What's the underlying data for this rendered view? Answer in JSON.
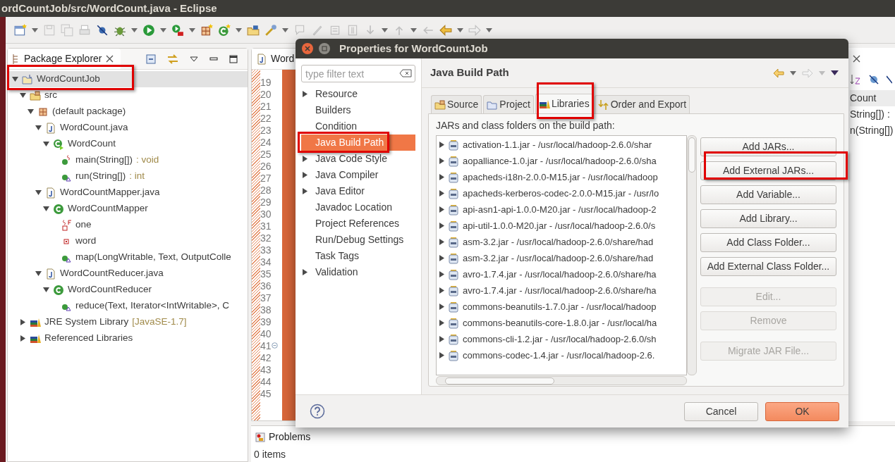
{
  "window": {
    "title": "ordCountJob/src/WordCount.java - Eclipse"
  },
  "package_explorer": {
    "tab": "Package Explorer",
    "tree": [
      {
        "label": "WordCountJob",
        "kind": "project",
        "expanded": true,
        "selected": true,
        "children": [
          {
            "label": "src",
            "kind": "source-folder",
            "expanded": true,
            "selected": false,
            "children": [
              {
                "label": "(default package)",
                "kind": "package",
                "expanded": true,
                "selected": false,
                "children": [
                  {
                    "label": "WordCount.java",
                    "kind": "java-file",
                    "expanded": true,
                    "selected": false,
                    "children": [
                      {
                        "label": "WordCount",
                        "kind": "main-class",
                        "expanded": true,
                        "selected": false,
                        "children": [
                          {
                            "label": "main(String[])",
                            "suffix": ": void",
                            "kind": "static-method",
                            "selected": false
                          },
                          {
                            "label": "run(String[])",
                            "suffix": ": int",
                            "kind": "method",
                            "selected": false
                          }
                        ]
                      }
                    ]
                  },
                  {
                    "label": "WordCountMapper.java",
                    "kind": "java-file",
                    "expanded": true,
                    "selected": false,
                    "children": [
                      {
                        "label": "WordCountMapper",
                        "kind": "class",
                        "expanded": true,
                        "selected": false,
                        "children": [
                          {
                            "label": "one",
                            "kind": "static-field",
                            "selected": false
                          },
                          {
                            "label": "word",
                            "kind": "field",
                            "selected": false
                          },
                          {
                            "label": "map(LongWritable, Text, OutputColle",
                            "kind": "method",
                            "selected": false
                          }
                        ]
                      }
                    ]
                  },
                  {
                    "label": "WordCountReducer.java",
                    "kind": "java-file",
                    "expanded": true,
                    "selected": false,
                    "children": [
                      {
                        "label": "WordCountReducer",
                        "kind": "class",
                        "expanded": true,
                        "selected": false,
                        "children": [
                          {
                            "label": "reduce(Text, Iterator<IntWritable>, C",
                            "kind": "method",
                            "selected": false
                          }
                        ]
                      }
                    ]
                  }
                ]
              }
            ]
          },
          {
            "label": "JRE System Library",
            "suffix": "[JavaSE-1.7]",
            "kind": "library",
            "expanded": false,
            "selected": false
          },
          {
            "label": "Referenced Libraries",
            "kind": "library",
            "expanded": false,
            "selected": false
          }
        ]
      }
    ]
  },
  "editor": {
    "tab": "Word",
    "lines": [
      {
        "number": "19",
        "fold_marker": false
      },
      {
        "number": "20",
        "fold_marker": false
      },
      {
        "number": "21",
        "fold_marker": false
      },
      {
        "number": "22",
        "fold_marker": false
      },
      {
        "number": "23",
        "fold_marker": false
      },
      {
        "number": "24",
        "fold_marker": false
      },
      {
        "number": "25",
        "fold_marker": false
      },
      {
        "number": "26",
        "fold_marker": false
      },
      {
        "number": "27",
        "fold_marker": false
      },
      {
        "number": "28",
        "fold_marker": false
      },
      {
        "number": "29",
        "fold_marker": false
      },
      {
        "number": "30",
        "fold_marker": false
      },
      {
        "number": "31",
        "fold_marker": false
      },
      {
        "number": "32",
        "fold_marker": false
      },
      {
        "number": "33",
        "fold_marker": false
      },
      {
        "number": "34",
        "fold_marker": false
      },
      {
        "number": "35",
        "fold_marker": false
      },
      {
        "number": "36",
        "fold_marker": false
      },
      {
        "number": "37",
        "fold_marker": false
      },
      {
        "number": "38",
        "fold_marker": false
      },
      {
        "number": "39",
        "fold_marker": false
      },
      {
        "number": "40",
        "fold_marker": false
      },
      {
        "number": "41",
        "fold_marker": true
      },
      {
        "number": "42",
        "fold_marker": false
      },
      {
        "number": "43",
        "fold_marker": false
      },
      {
        "number": "44",
        "fold_marker": false
      },
      {
        "number": "45",
        "fold_marker": false
      }
    ]
  },
  "outline": {
    "rows": [
      {
        "label": "Count",
        "selected": true
      },
      {
        "label": "String[]) :",
        "selected": false
      },
      {
        "label": "n(String[])",
        "selected": false
      }
    ]
  },
  "problems": {
    "tab": "Problems",
    "status": "0 items"
  },
  "dialog": {
    "title": "Properties for WordCountJob",
    "filter": {
      "placeholder": "type filter text"
    },
    "categories": [
      {
        "label": "Resource",
        "expanded": false,
        "selected": false
      },
      {
        "label": "Builders",
        "selected": false
      },
      {
        "label": "Condition",
        "selected": false
      },
      {
        "label": "Java Build Path",
        "selected": true
      },
      {
        "label": "Java Code Style",
        "expanded": false,
        "selected": false
      },
      {
        "label": "Java Compiler",
        "expanded": false,
        "selected": false
      },
      {
        "label": "Java Editor",
        "expanded": false,
        "selected": false
      },
      {
        "label": "Javadoc Location",
        "selected": false
      },
      {
        "label": "Project References",
        "selected": false
      },
      {
        "label": "Run/Debug Settings",
        "selected": false
      },
      {
        "label": "Task Tags",
        "selected": false
      },
      {
        "label": "Validation",
        "expanded": false,
        "selected": false
      }
    ],
    "page_title": "Java Build Path",
    "tabs": [
      {
        "label": "Source",
        "kind": "source",
        "selected": false
      },
      {
        "label": "Project",
        "kind": "projects",
        "selected": false
      },
      {
        "label": "Libraries",
        "kind": "libraries",
        "selected": true
      },
      {
        "label": "Order and Export",
        "kind": "order",
        "selected": false
      }
    ],
    "list_label": "JARs and class folders on the build path:",
    "entries": [
      {
        "label": "activation-1.1.jar - /usr/local/hadoop-2.6.0/shar",
        "expanded": false
      },
      {
        "label": "aopalliance-1.0.jar - /usr/local/hadoop-2.6.0/sha",
        "expanded": false
      },
      {
        "label": "apacheds-i18n-2.0.0-M15.jar - /usr/local/hadoop",
        "expanded": false
      },
      {
        "label": "apacheds-kerberos-codec-2.0.0-M15.jar - /usr/lo",
        "expanded": false
      },
      {
        "label": "api-asn1-api-1.0.0-M20.jar - /usr/local/hadoop-2",
        "expanded": false
      },
      {
        "label": "api-util-1.0.0-M20.jar - /usr/local/hadoop-2.6.0/s",
        "expanded": false
      },
      {
        "label": "asm-3.2.jar - /usr/local/hadoop-2.6.0/share/had",
        "expanded": false
      },
      {
        "label": "asm-3.2.jar - /usr/local/hadoop-2.6.0/share/had",
        "expanded": false
      },
      {
        "label": "avro-1.7.4.jar - /usr/local/hadoop-2.6.0/share/ha",
        "expanded": false
      },
      {
        "label": "avro-1.7.4.jar - /usr/local/hadoop-2.6.0/share/ha",
        "expanded": false
      },
      {
        "label": "commons-beanutils-1.7.0.jar - /usr/local/hadoop",
        "expanded": false
      },
      {
        "label": "commons-beanutils-core-1.8.0.jar - /usr/local/ha",
        "expanded": false
      },
      {
        "label": "commons-cli-1.2.jar - /usr/local/hadoop-2.6.0/sh",
        "expanded": false
      },
      {
        "label": "commons-codec-1.4.jar - /usr/local/hadoop-2.6.",
        "expanded": false
      }
    ],
    "button_groups": [
      [
        {
          "label": "Add JARs...",
          "disabled": false
        },
        {
          "label": "Add External JARs...",
          "disabled": false
        },
        {
          "label": "Add Variable...",
          "disabled": false
        },
        {
          "label": "Add Library...",
          "disabled": false
        },
        {
          "label": "Add Class Folder...",
          "disabled": false
        },
        {
          "label": "Add External Class Folder...",
          "disabled": false
        }
      ],
      [
        {
          "label": "Edit...",
          "disabled": true
        },
        {
          "label": "Remove",
          "disabled": true
        }
      ],
      [
        {
          "label": "Migrate JAR File...",
          "disabled": true
        }
      ]
    ],
    "footer_buttons": [
      {
        "label": "Cancel",
        "default": false
      },
      {
        "label": "OK",
        "default": true
      }
    ]
  }
}
